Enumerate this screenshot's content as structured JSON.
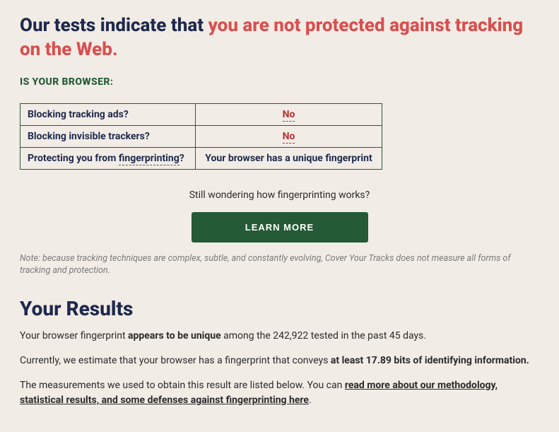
{
  "heading": {
    "prefix": "Our tests indicate that ",
    "highlight": "you are not protected against tracking on the Web."
  },
  "browser_question": "IS YOUR BROWSER:",
  "table": {
    "rows": [
      {
        "label": "Blocking tracking ads?",
        "answer": "No",
        "answer_type": "no"
      },
      {
        "label": "Blocking invisible trackers?",
        "answer": "No",
        "answer_type": "no"
      },
      {
        "label_prefix": "Protecting you from ",
        "label_term": "fingerprinting",
        "label_suffix": "?",
        "answer": "Your browser has a unique fingerprint",
        "answer_type": "plain"
      }
    ]
  },
  "still_wondering": "Still wondering how fingerprinting works?",
  "learn_more_label": "LEARN MORE",
  "note": "Note: because tracking techniques are complex, subtle, and constantly evolving, Cover Your Tracks does not measure all forms of tracking and protection.",
  "results_heading": "Your Results",
  "para1": {
    "p1": "Your browser fingerprint ",
    "bold": "appears to be unique",
    "p2": " among the 242,922 tested in the past 45 days."
  },
  "para2": {
    "p1": "Currently, we estimate that your browser has a fingerprint that conveys ",
    "bold": "at least 17.89 bits of identifying information."
  },
  "para3": {
    "p1": "The measurements we used to obtain this result are listed below. You can ",
    "link": "read more about our methodology, statistical results, and some defenses against fingerprinting here",
    "p2": "."
  }
}
